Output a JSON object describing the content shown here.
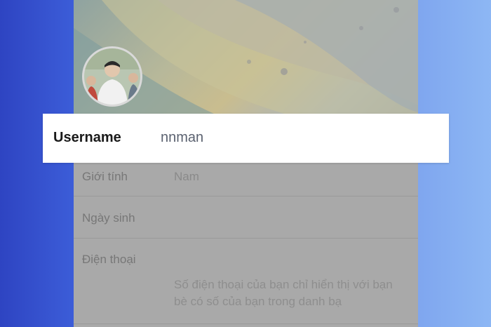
{
  "profile": {
    "username_label": "Username",
    "username_value": "nnman",
    "rows": [
      {
        "label": "Giới tính",
        "value": "Nam"
      },
      {
        "label": "Ngày sinh",
        "value": ""
      },
      {
        "label": "Điện thoại",
        "value": ""
      }
    ],
    "phone_hint": "Số điện thoại của bạn chỉ hiển thị với bạn bè có số của bạn trong danh bạ"
  },
  "colors": {
    "highlight_bg": "#ffffff",
    "dim_overlay": "#a9a9a9",
    "background_left": "#2f4fd0",
    "background_right": "#88b2f3"
  }
}
